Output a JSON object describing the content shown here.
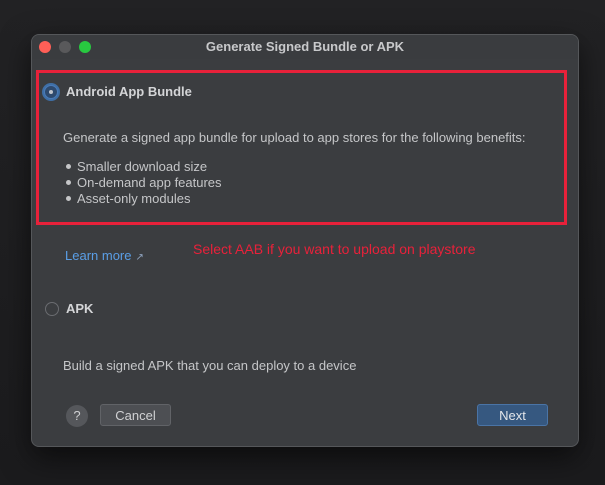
{
  "window": {
    "title": "Generate Signed Bundle or APK"
  },
  "options": {
    "bundle": {
      "label": "Android App Bundle",
      "selected": true,
      "description": "Generate a signed app bundle for upload to app stores for the following benefits:",
      "benefits": [
        "Smaller download size",
        "On-demand app features",
        "Asset-only modules"
      ],
      "learn_more": "Learn more",
      "learn_more_icon": "external-link-icon"
    },
    "apk": {
      "label": "APK",
      "selected": false,
      "description": "Build a signed APK that you can deploy to a device"
    }
  },
  "annotation": {
    "text": "Select AAB if you want to upload on playstore",
    "color": "#e8213a"
  },
  "footer": {
    "help_label": "?",
    "cancel_label": "Cancel",
    "next_label": "Next"
  },
  "colors": {
    "accent": "#365880",
    "link": "#5a9ee6",
    "highlight": "#e8213a"
  }
}
